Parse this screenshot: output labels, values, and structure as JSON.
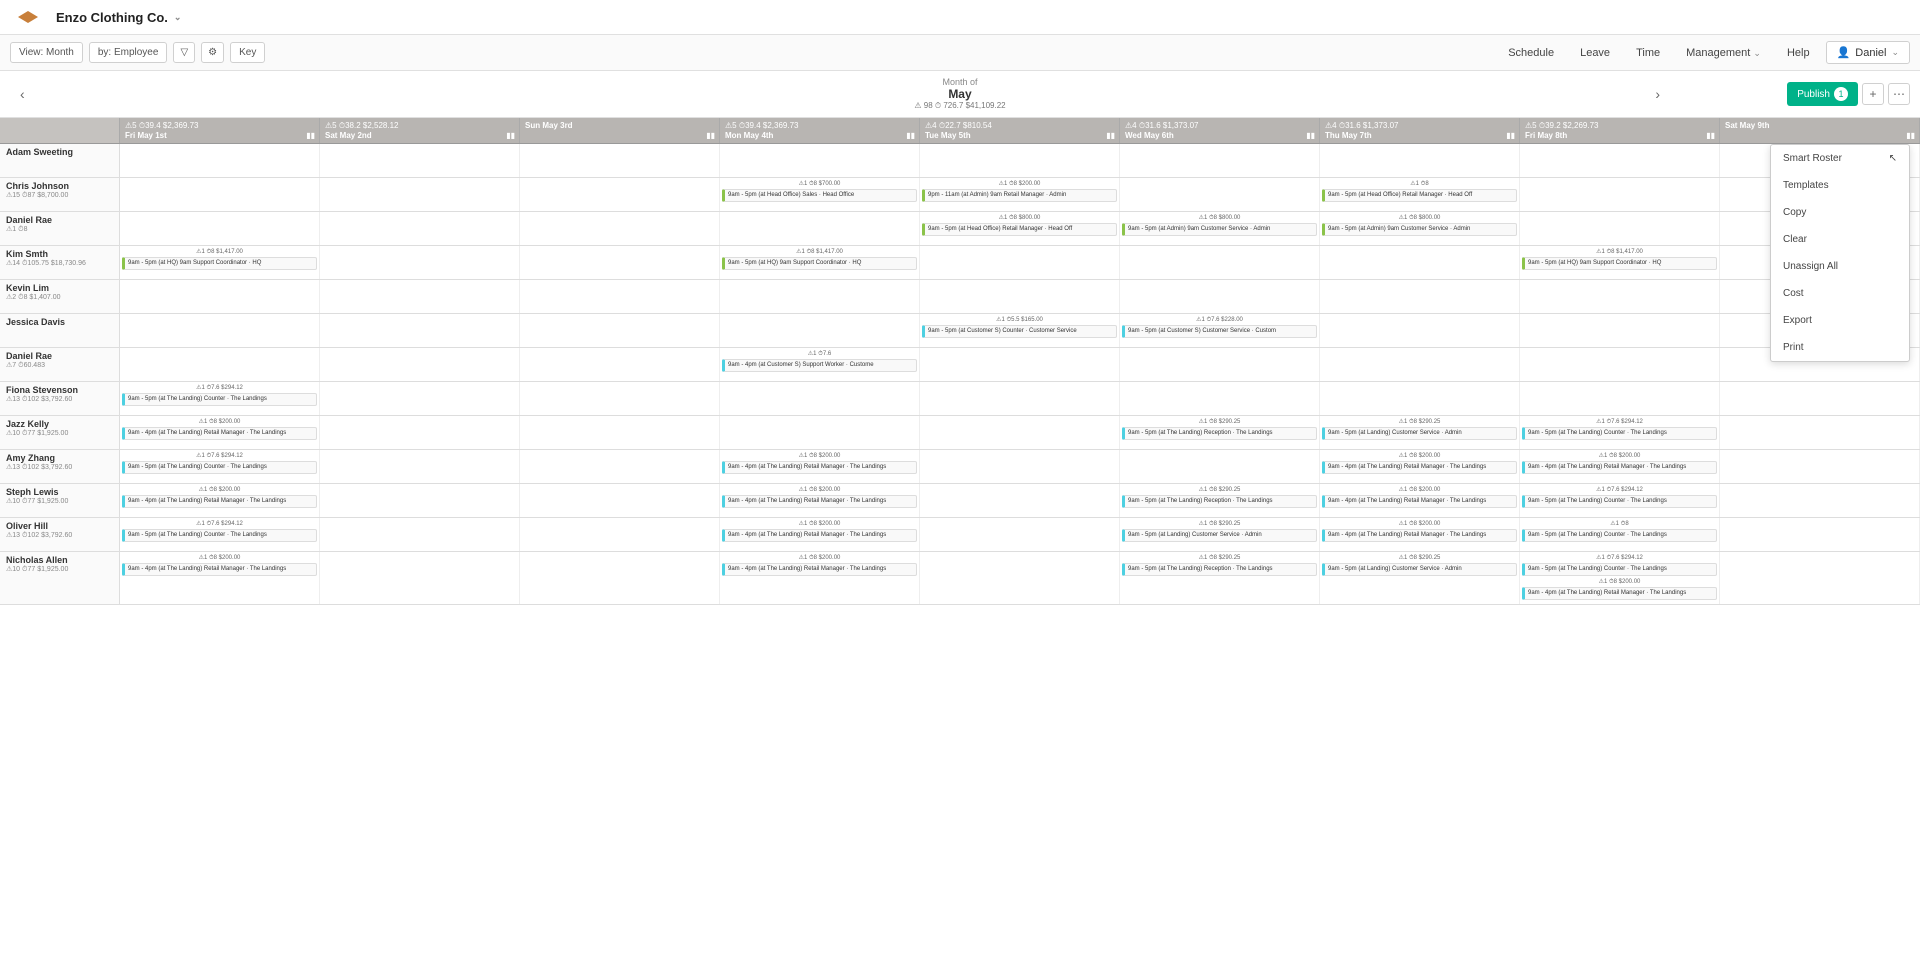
{
  "company": "Enzo Clothing Co.",
  "toolbar": {
    "view": "View: Month",
    "by": "by: Employee",
    "key": "Key"
  },
  "nav": [
    "Schedule",
    "Leave",
    "Time",
    "Management",
    "Help"
  ],
  "user": "Daniel",
  "month": {
    "label": "Month of",
    "name": "May",
    "totals": "⚠ 98 ⏱ 726.7 $41,109.22"
  },
  "publish": {
    "label": "Publish",
    "count": "1"
  },
  "days": [
    {
      "stats": "⚠5 ⏱39.4  $2,369.73",
      "name": "Fri May 1st"
    },
    {
      "stats": "⚠5 ⏱38.2  $2,528.12",
      "name": "Sat May 2nd"
    },
    {
      "stats": "",
      "name": "Sun May 3rd"
    },
    {
      "stats": "⚠5 ⏱39.4  $2,369.73",
      "name": "Mon May 4th"
    },
    {
      "stats": "⚠4 ⏱22.7  $810.54",
      "name": "Tue May 5th"
    },
    {
      "stats": "⚠4 ⏱31.6  $1,373.07",
      "name": "Wed May 6th"
    },
    {
      "stats": "⚠4 ⏱31.6  $1,373.07",
      "name": "Thu May 7th"
    },
    {
      "stats": "⚠5 ⏱39.2  $2,269.73",
      "name": "Fri May 8th"
    },
    {
      "stats": "",
      "name": "Sat May 9th"
    }
  ],
  "employees": [
    {
      "name": "Adam Sweeting",
      "stats": ""
    },
    {
      "name": "Chris Johnson",
      "stats": "⚠15 ⏱87 $8,700.00"
    },
    {
      "name": "Daniel Rae",
      "stats": "⚠1 ⏱8"
    },
    {
      "name": "Kim Smth",
      "stats": "⚠14 ⏱105.75 $18,730.96"
    },
    {
      "name": "Kevin Lim",
      "stats": "⚠2 ⏱8 $1,407.00"
    },
    {
      "name": "Jessica Davis",
      "stats": ""
    },
    {
      "name": "Daniel Rae",
      "stats": "⚠7 ⏱60.483"
    },
    {
      "name": "Fiona Stevenson",
      "stats": "⚠13 ⏱102 $3,792.60"
    },
    {
      "name": "Jazz Kelly",
      "stats": "⚠10 ⏱77 $1,925.00"
    },
    {
      "name": "Amy Zhang",
      "stats": "⚠13 ⏱102 $3,792.60"
    },
    {
      "name": "Steph Lewis",
      "stats": "⚠10 ⏱77 $1,925.00"
    },
    {
      "name": "Oliver Hill",
      "stats": "⚠13 ⏱102 $3,792.60"
    },
    {
      "name": "Nicholas Allen",
      "stats": "⚠10 ⏱77 $1,925.00"
    }
  ],
  "shifts": {
    "stat_8_200": "⚠1 ⏱8  $200.00",
    "stat_8_1417": "⚠1 ⏱8  $1,417.00",
    "stat_8_700": "⚠1 ⏱8  $700.00",
    "stat_8_800": "⚠1 ⏱8  $800.00",
    "stat_8_290": "⚠1 ⏱8  $290.25",
    "stat_55_165": "⚠1 ⏱5.5  $165.00",
    "stat_76_228": "⚠1 ⏱7.6 $228.00",
    "stat_76_294": "⚠1 ⏱7.6  $294.12",
    "stat_76": "⚠1 ⏱7.6",
    "stat_8": "⚠1 ⏱8",
    "detail_headoffice": "9am - 5pm (at Head Office) Sales · Head Office",
    "detail_hq": "9am - 5pm (at HQ) 9am Support Coordinator · HQ",
    "detail_admin": "9pm - 11am (at Admin) 9am Retail Manager · Admin",
    "detail_adminsvc": "9am - 5pm (at Admin) 9am Customer Service · Admin",
    "detail_retailhead": "9am - 5pm (at Head Office) Retail Manager · Head Off",
    "detail_landing": "9am - 5pm (at The Landing) Counter · The Landings",
    "detail_landingmgr": "9am - 4pm (at The Landing) Retail Manager · The Landings",
    "detail_landingrecep": "9am - 5pm (at The Landing) Reception · The Landings",
    "detail_landingsvc": "9am - 5pm (at Landing) Customer Service · Admin",
    "detail_custsvc": "9am - 5pm (at Customer S) Counter · Customer Service",
    "detail_custsvc2": "9am - 5pm (at Customer S) Customer Service · Custom",
    "detail_custsvc3": "9am - 4pm (at Customer S) Support Worker · Custome"
  },
  "dropdown": [
    "Smart Roster",
    "Templates",
    "Copy",
    "Clear",
    "Unassign All",
    "Cost",
    "Export",
    "Print"
  ]
}
